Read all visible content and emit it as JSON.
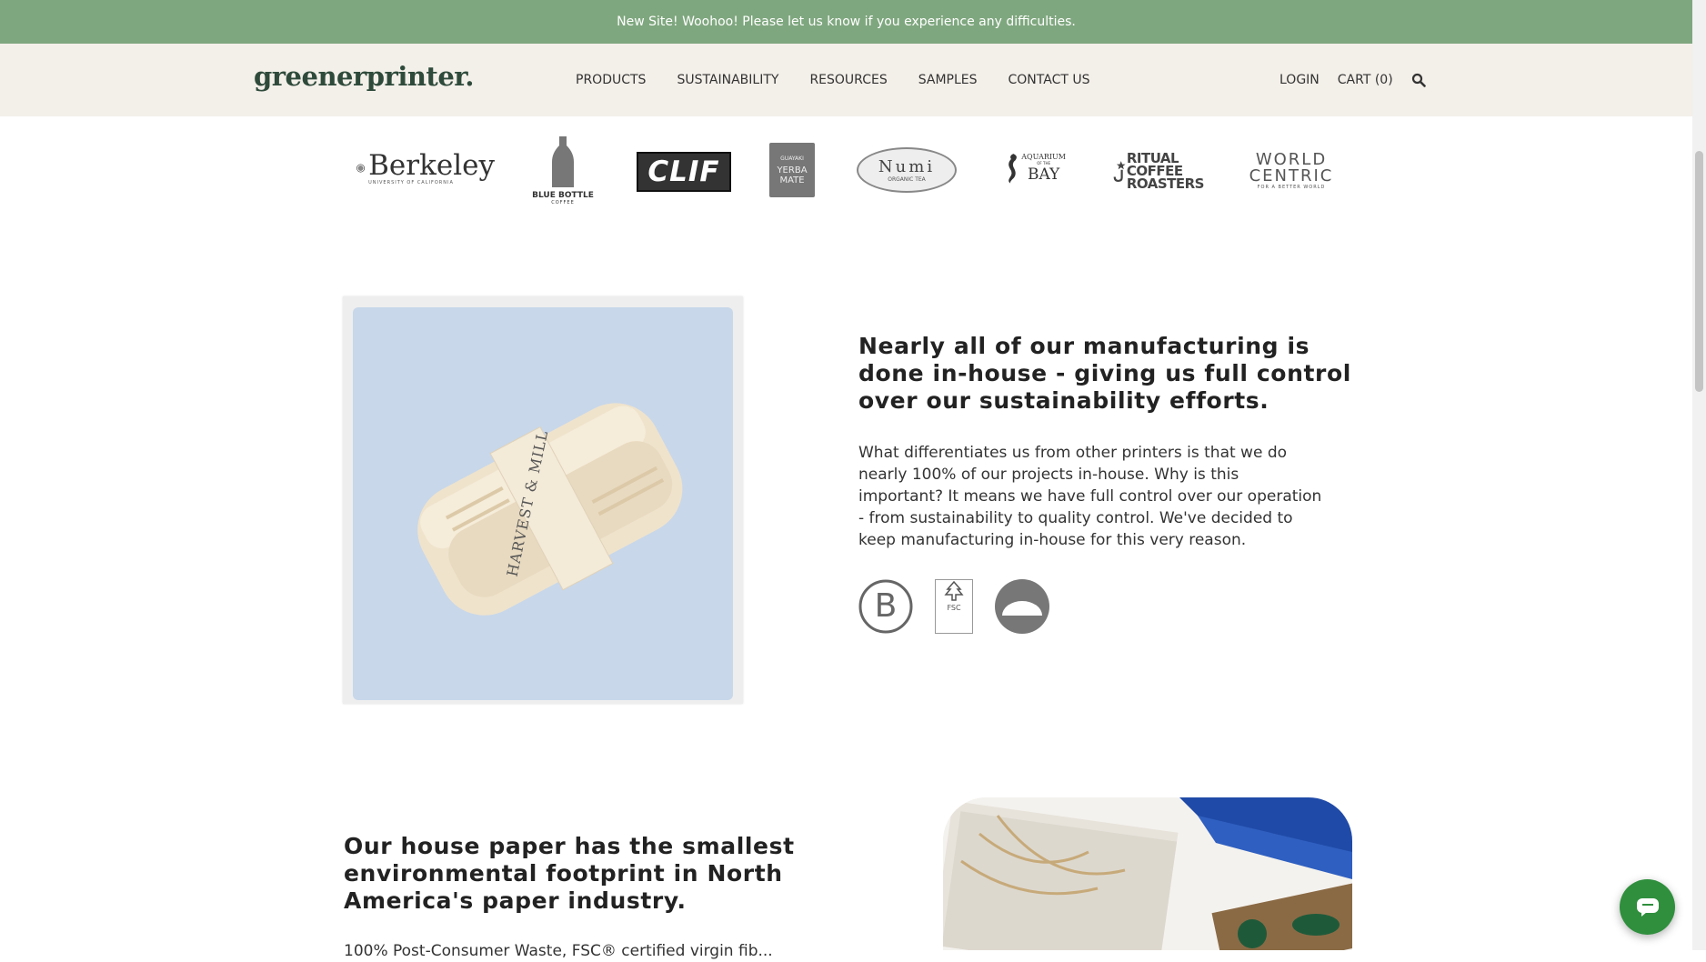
{
  "announcement": {
    "text": "New Site! Woohoo! Please let us know if you experience any difficulties."
  },
  "header": {
    "logo": "greenerprinter.",
    "nav": [
      {
        "label": "PRODUCTS"
      },
      {
        "label": "SUSTAINABILITY"
      },
      {
        "label": "RESOURCES"
      },
      {
        "label": "SAMPLES"
      },
      {
        "label": "CONTACT US"
      }
    ],
    "login": "LOGIN",
    "cart": "CART (0)",
    "search_icon": "search-icon"
  },
  "client_logos": {
    "berkeley": {
      "name": "Berkeley",
      "sub": "UNIVERSITY OF CALIFORNIA"
    },
    "blue_bottle": {
      "name": "BLUE BOTTLE",
      "sub": "COFFEE"
    },
    "clif": {
      "name": "CLIF"
    },
    "guayaki": {
      "top": "GUAYAKI",
      "name": "YERBA MATE"
    },
    "numi": {
      "name": "Numi",
      "sub": "ORGANIC TEA"
    },
    "aquarium": {
      "top": "AQUARIUM",
      "sub": "OF THE",
      "name": "BAY"
    },
    "ritual": {
      "lines": [
        "RITUAL",
        "COFFEE",
        "ROASTERS"
      ]
    },
    "world_centric": {
      "lines": [
        "WORLD",
        "CENTRIC"
      ],
      "sub": "FOR A BETTER WORLD"
    }
  },
  "section_inhouse": {
    "heading": "Nearly all of our manufacturing is done in-house - giving us full control over our sustainability efforts.",
    "body": "What differentiates us from other printers is that we do nearly 100% of our projects in-house. Why is this important? It means we have full control over our operation - from sustainability to quality control. We've decided to keep manufacturing in-house for this very reason.",
    "product_label": "HARVEST & MILL",
    "certifications": [
      {
        "icon": "b-corp-icon",
        "label": "B"
      },
      {
        "icon": "fsc-icon",
        "label": "FSC"
      },
      {
        "icon": "sunrise-badge-icon",
        "label": ""
      }
    ]
  },
  "section_paper": {
    "heading": "Our house paper has the smallest environmental footprint in North America's paper industry.",
    "body": "100% Post-Consumer Waste, FSC® certified virgin fib..."
  },
  "chat": {
    "icon": "chat-icon"
  },
  "colors": {
    "announcement_bg": "#7fa77f",
    "header_bg": "#f3efe9",
    "logo_green": "#2e4a3a",
    "chat_green": "#2f8f3d"
  }
}
